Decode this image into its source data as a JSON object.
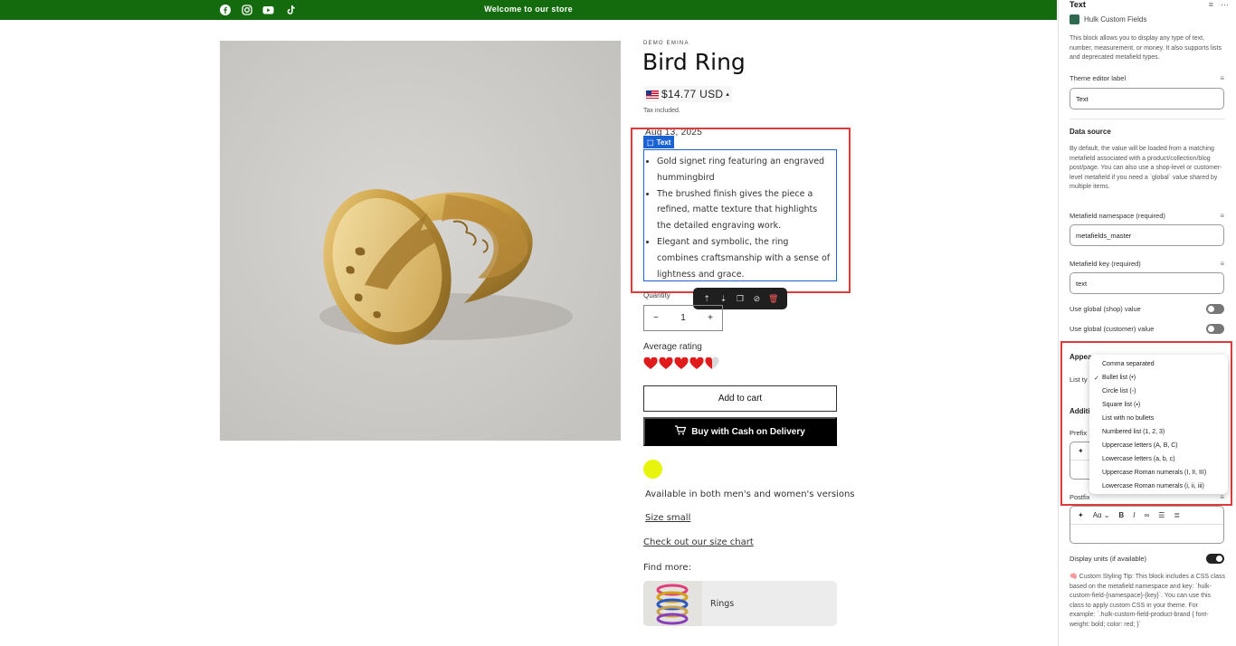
{
  "store": {
    "announcement": "Welcome to our store",
    "socials": [
      "facebook-icon",
      "instagram-icon",
      "youtube-icon",
      "tiktok-icon"
    ]
  },
  "product": {
    "vendor": "DEMO EMINA",
    "title": "Bird Ring",
    "price": "$14.77 USD",
    "tax_note": "Tax included.",
    "date": "Aug 13, 2025",
    "block_badge": "Text",
    "bullets": [
      "Gold signet ring featuring an engraved hummingbird",
      "The brushed finish gives the piece a refined, matte texture that highlights the detailed engraving work.",
      "Elegant and symbolic, the ring combines craftsmanship with a sense of lightness and grace."
    ],
    "quantity_label": "Quantity",
    "quantity_value": "1",
    "quantity_minus": "−",
    "quantity_plus": "+",
    "rating_label": "Average rating",
    "rating_value": 4.5,
    "rating_max": 5,
    "add_to_cart": "Add to cart",
    "buy_cod": "Buy with Cash on Delivery",
    "swatch_color": "#e8f40b",
    "availability": "Available in both men's and women's versions",
    "size_link": "Size small",
    "size_chart_link": "Check out our size chart",
    "find_more": "Find more:",
    "collection_label": "Rings"
  },
  "panel": {
    "title": "Text",
    "app_name": "Hulk Custom Fields",
    "description": "This block allows you to display any type of text, number, measurement, or money. It also supports lists and deprecated metafield types.",
    "theme_editor_label": "Theme editor label",
    "theme_editor_value": "Text",
    "data_source_heading": "Data source",
    "data_source_desc": "By default, the value will be loaded from a matching metafield associated with a product/collection/blog post/page. You can also use a shop-level or customer-level metafield if you need a `global` value shared by multiple items.",
    "namespace_label": "Metafield namespace (required)",
    "namespace_value": "metafields_master",
    "key_label": "Metafield key (required)",
    "key_value": "text",
    "global_shop_label": "Use global (shop) value",
    "global_customer_label": "Use global (customer) value",
    "appearance_heading": "Appear",
    "list_type_label": "List ty",
    "additional_heading": "Additi",
    "prefix_label": "Prefix",
    "postfix_label": "Postfix",
    "display_units_label": "Display units (if available)",
    "tip": "🧠 Custom Styling Tip: This block includes a CSS class based on the metafield namespace and key: `hulk-custom-field-{namespace}-{key}`. You can use this class to apply custom CSS in your theme. For example: `.hulk-custom-field-product-brand { font-weight: bold; color: red; }`",
    "list_options": [
      "Comma separated",
      "Bullet list (•)",
      "Circle list (◦)",
      "Square list (▪)",
      "List with no bullets",
      "Numbered list (1, 2, 3)",
      "Uppercase letters (A, B, C)",
      "Lowercase letters (a, b, c)",
      "Uppercase Roman numerals (I, II, III)",
      "Lowercase Roman numerals (i, ii, iii)"
    ],
    "selected_option_index": 1
  },
  "colors": {
    "announcement_bg": "#146b0d",
    "editor_blue": "#1b62d2",
    "highlight_red": "#e03b3b"
  }
}
